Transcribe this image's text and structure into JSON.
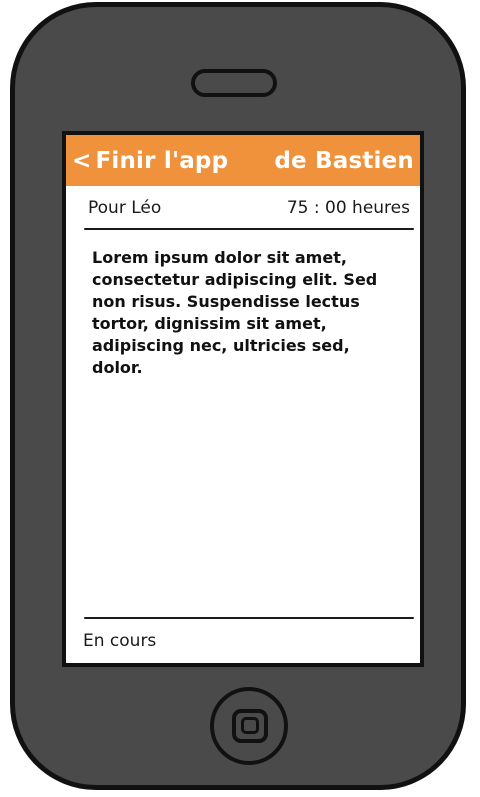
{
  "header": {
    "back_glyph": "<",
    "back_label": "Finir l'app",
    "right_label": "de Bastien",
    "background_color": "#f0923b",
    "text_color": "#ffffff"
  },
  "detail": {
    "recipient": "Pour Léo",
    "duration": "75 : 00 heures",
    "body": "Lorem ipsum dolor sit amet, consectetur adipiscing elit. Sed non risus. Suspendisse lectus tortor, dignissim sit amet, adipiscing nec, ultricies sed, dolor."
  },
  "footer": {
    "status": "En cours"
  },
  "device": {
    "body_color": "#4a4a4a",
    "outline_color": "#111111",
    "speaker_icon": "speaker-icon",
    "home_icon": "home-button-icon"
  }
}
